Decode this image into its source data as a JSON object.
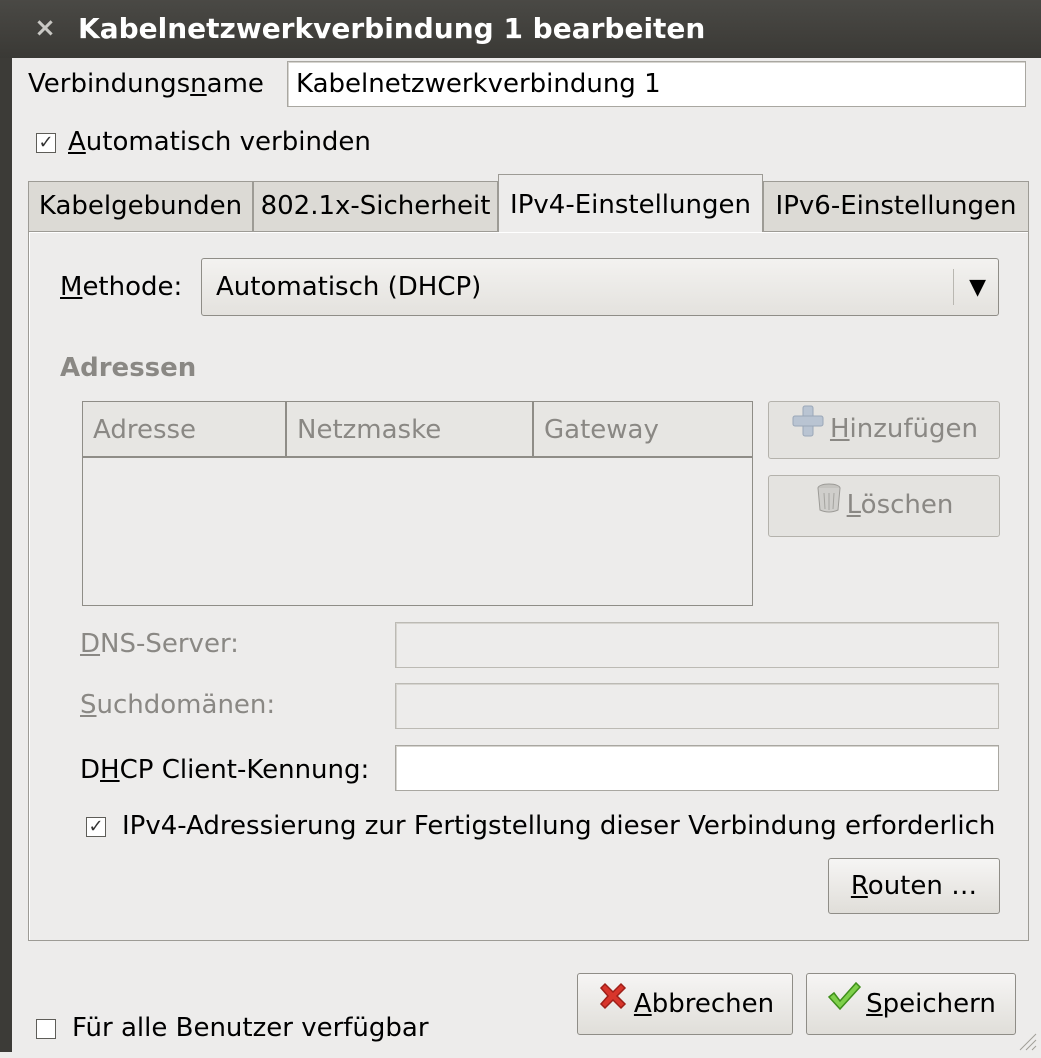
{
  "window": {
    "title": "Kabelnetzwerkverbindung 1 bearbeiten",
    "close_glyph": "×"
  },
  "connection_name": {
    "label_pre": "Verbindungs",
    "label_mnemonic": "n",
    "label_post": "ame",
    "value": "Kabelnetzwerkverbindung 1"
  },
  "auto_connect": {
    "checked": true,
    "check_glyph": "☑",
    "label_mnemonic": "A",
    "label_post": "utomatisch verbinden"
  },
  "tabs": [
    {
      "label": "Kabelgebunden",
      "active": false
    },
    {
      "label": "802.1x-Sicherheit",
      "active": false
    },
    {
      "label": "IPv4-Einstellungen",
      "active": true
    },
    {
      "label": "IPv6-Einstellungen",
      "active": false
    }
  ],
  "method": {
    "label_mnemonic": "M",
    "label_post": "ethode:",
    "value": "Automatisch (DHCP)",
    "arrow_glyph": "▼"
  },
  "addresses": {
    "title": "Adressen",
    "columns": [
      "Adresse",
      "Netzmaske",
      "Gateway"
    ],
    "rows": [],
    "add_button": {
      "icon": "plus-icon",
      "mnemonic": "H",
      "label_post": "inzufügen"
    },
    "delete_button": {
      "icon": "trash-icon",
      "mnemonic": "L",
      "label_post": "öschen"
    }
  },
  "dns": {
    "label_mnemonic": "D",
    "label_post": "NS-Server:",
    "value": ""
  },
  "search_domains": {
    "label_mnemonic": "S",
    "label_post": "uchdomänen:",
    "value": ""
  },
  "dhcp_client_id": {
    "label_pre": "D",
    "label_mnemonic": "H",
    "label_post": "CP Client-Kennung:",
    "value": ""
  },
  "require_ipv4": {
    "checked": true,
    "check_glyph": "☑",
    "label": "IPv4-Adressierung zur Fertigstellung dieser Verbindung erforderlich"
  },
  "routes_button": {
    "mnemonic": "R",
    "label_post": "outen …"
  },
  "all_users": {
    "checked": false,
    "label": "Für alle Benutzer verfügbar"
  },
  "cancel_button": {
    "icon": "cancel-x-icon",
    "mnemonic": "A",
    "label_post": "bbrechen"
  },
  "save_button": {
    "icon": "checkmark-icon",
    "mnemonic": "S",
    "label_post": "peichern"
  },
  "colors": {
    "titlebar": "#3c3b37",
    "window_bg": "#edeceb",
    "disabled_text": "#8a8884",
    "cancel_red": "#d8352b",
    "save_green": "#5cb82c"
  }
}
